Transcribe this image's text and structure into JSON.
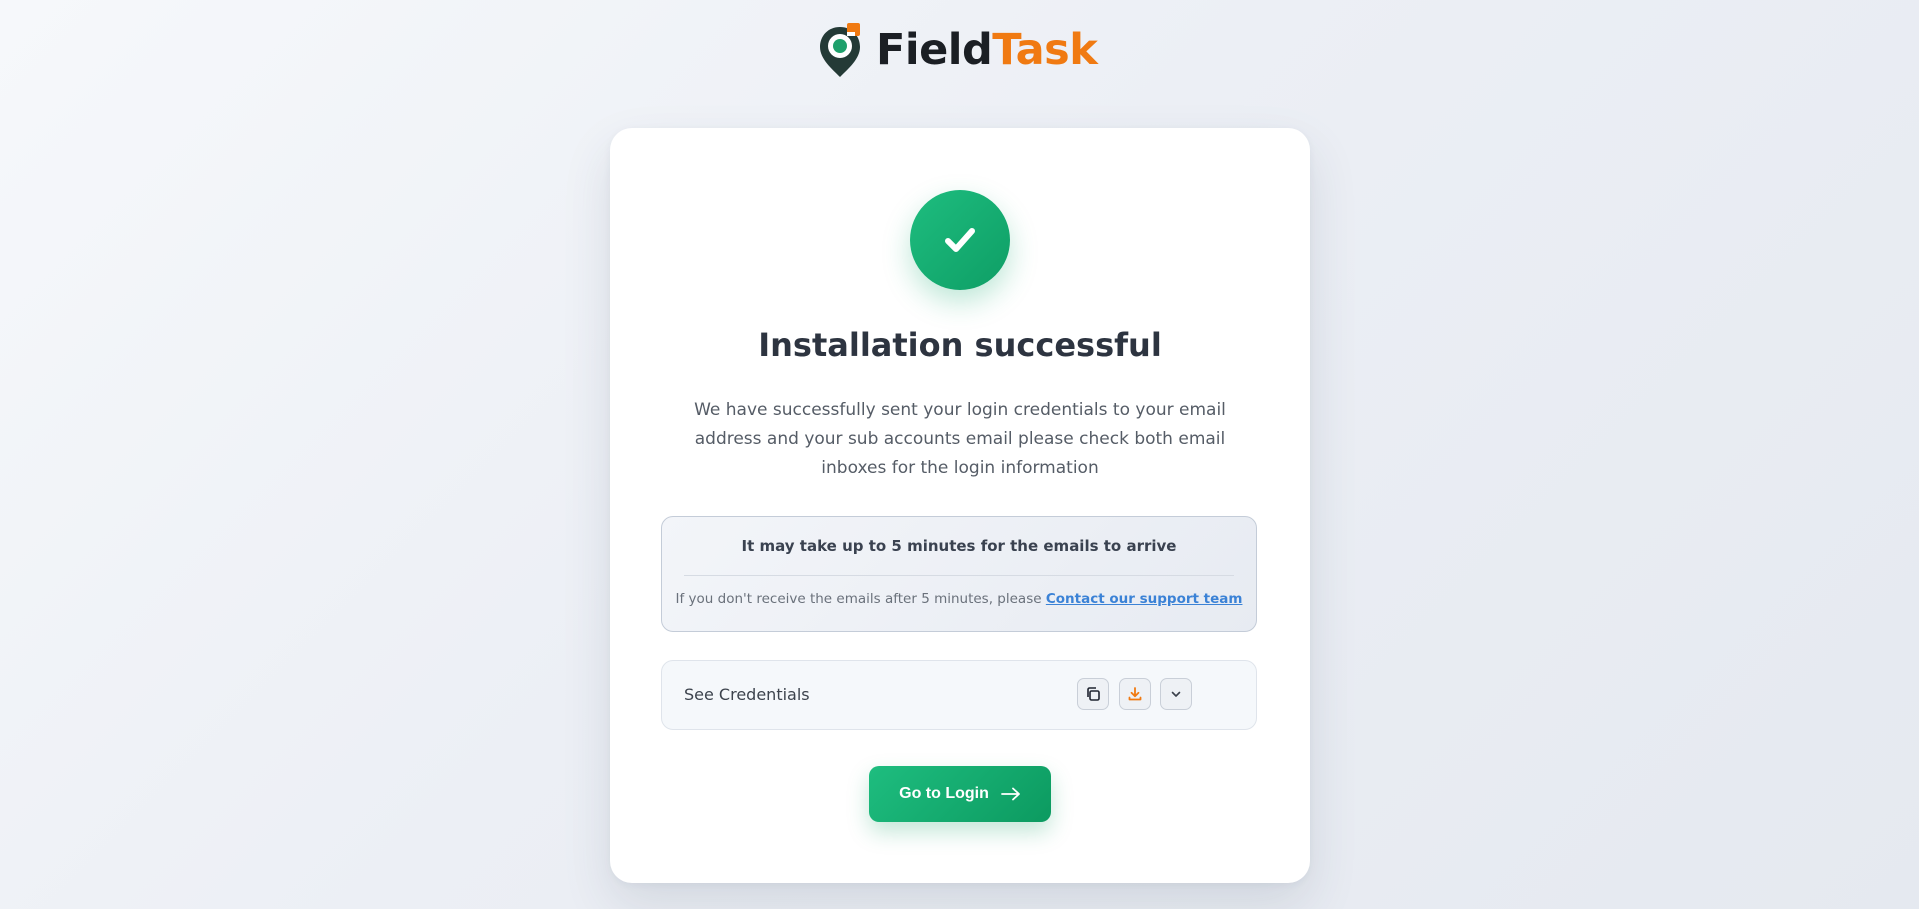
{
  "brand": {
    "name_part1": "Field",
    "name_part2": "Task",
    "colors": {
      "dark": "#1b1f24",
      "orange": "#f07a12",
      "green": "#1ea06b"
    }
  },
  "status": {
    "icon": "check-icon",
    "color": "#1ebd7f",
    "title": "Installation successful",
    "message": "We have successfully sent your login credentials to your email address and your sub accounts email please check both email inboxes for the login information"
  },
  "notice": {
    "headline": "It may take up to 5 minutes for the emails to arrive",
    "subtext": "If you don't receive the emails after 5 minutes, please",
    "link_text": "Contact our support team"
  },
  "credentials": {
    "label": "See Credentials",
    "actions": [
      {
        "icon": "copy-icon"
      },
      {
        "icon": "download-icon",
        "color": "#f07a12"
      },
      {
        "icon": "chevron-down-icon"
      }
    ]
  },
  "primary_action": {
    "label": "Go to Login",
    "icon": "arrow-right-icon",
    "color": "#12a86e"
  }
}
